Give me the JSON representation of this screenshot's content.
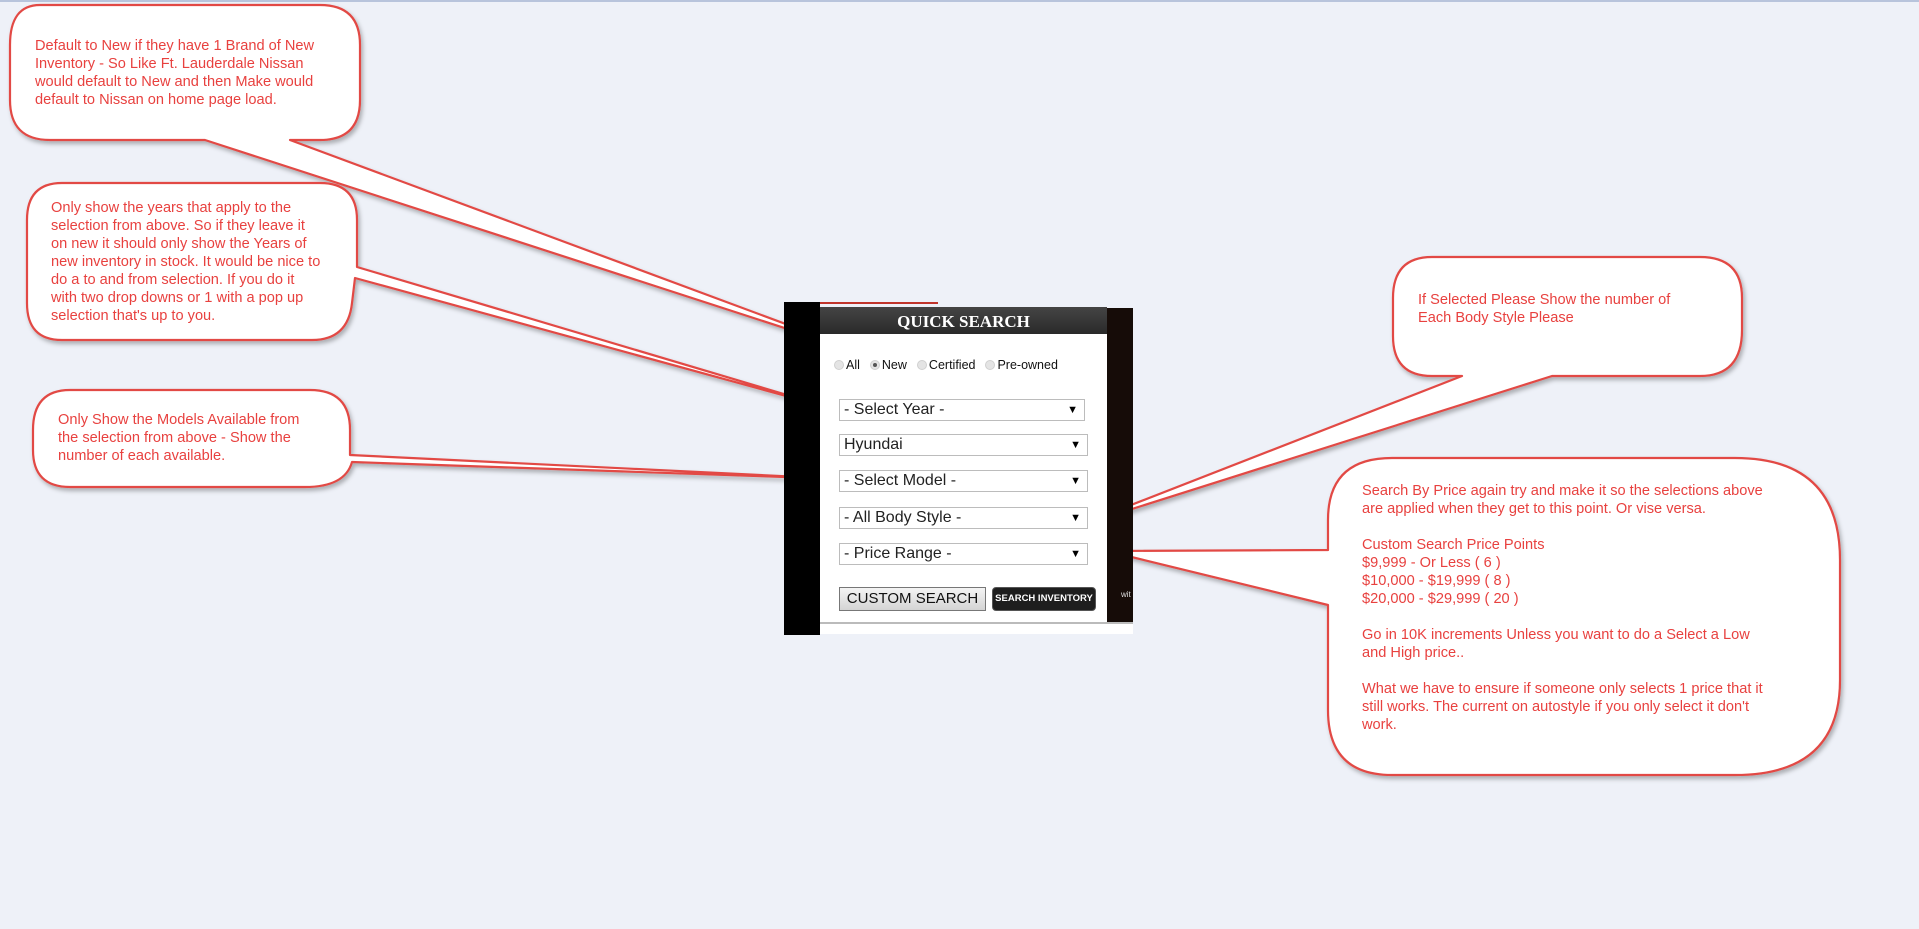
{
  "notes": {
    "default_new": "Default to New if they have 1 Brand of New\nInventory - So Like Ft. Lauderdale Nissan\nwould default to New and then Make would\ndefault to Nissan on home page load.",
    "years": "Only show the years that apply to the\nselection from above. So if they leave it\non new it should only show the Years of\nnew inventory in stock. It would be nice to\ndo a to and from selection. If you do it\nwith two drop downs or 1 with a pop up\nselection that's up to you.",
    "models": "Only Show the Models Available from\nthe selection from above - Show the\nnumber of each available.",
    "body_style": "If Selected Please Show the number of\nEach Body Style Please",
    "price": "Search By Price again try and make it so the selections above\nare applied when they get to this point. Or vise versa.\n\nCustom Search Price Points\n$9,999   -  Or Less ( 6 )\n$10,000 - $19,999 ( 8 )\n$20,000 - $29,999 ( 20 )\n\nGo in 10K increments Unless you want to do a Select a Low\nand High price..\n\nWhat we have to ensure if someone only selects 1 price that it\nstill works. The current on autostyle if you only select it don't\nwork."
  },
  "quick_search": {
    "title": "QUICK SEARCH",
    "conditions": [
      "All",
      "New",
      "Certified",
      "Pre-owned"
    ],
    "selected_condition": "New",
    "year_select": "- Select Year -",
    "make_select": "Hyundai",
    "model_select": "- Select Model -",
    "body_select": "- All Body Style -",
    "price_select": "- Price Range -",
    "custom_search_label": "CUSTOM SEARCH",
    "search_inventory_label": "SEARCH INVENTORY",
    "arrow_glyph": "▼",
    "side_text": "wit"
  },
  "colors": {
    "annotation": "#e8413f",
    "background": "#eef1f8"
  }
}
